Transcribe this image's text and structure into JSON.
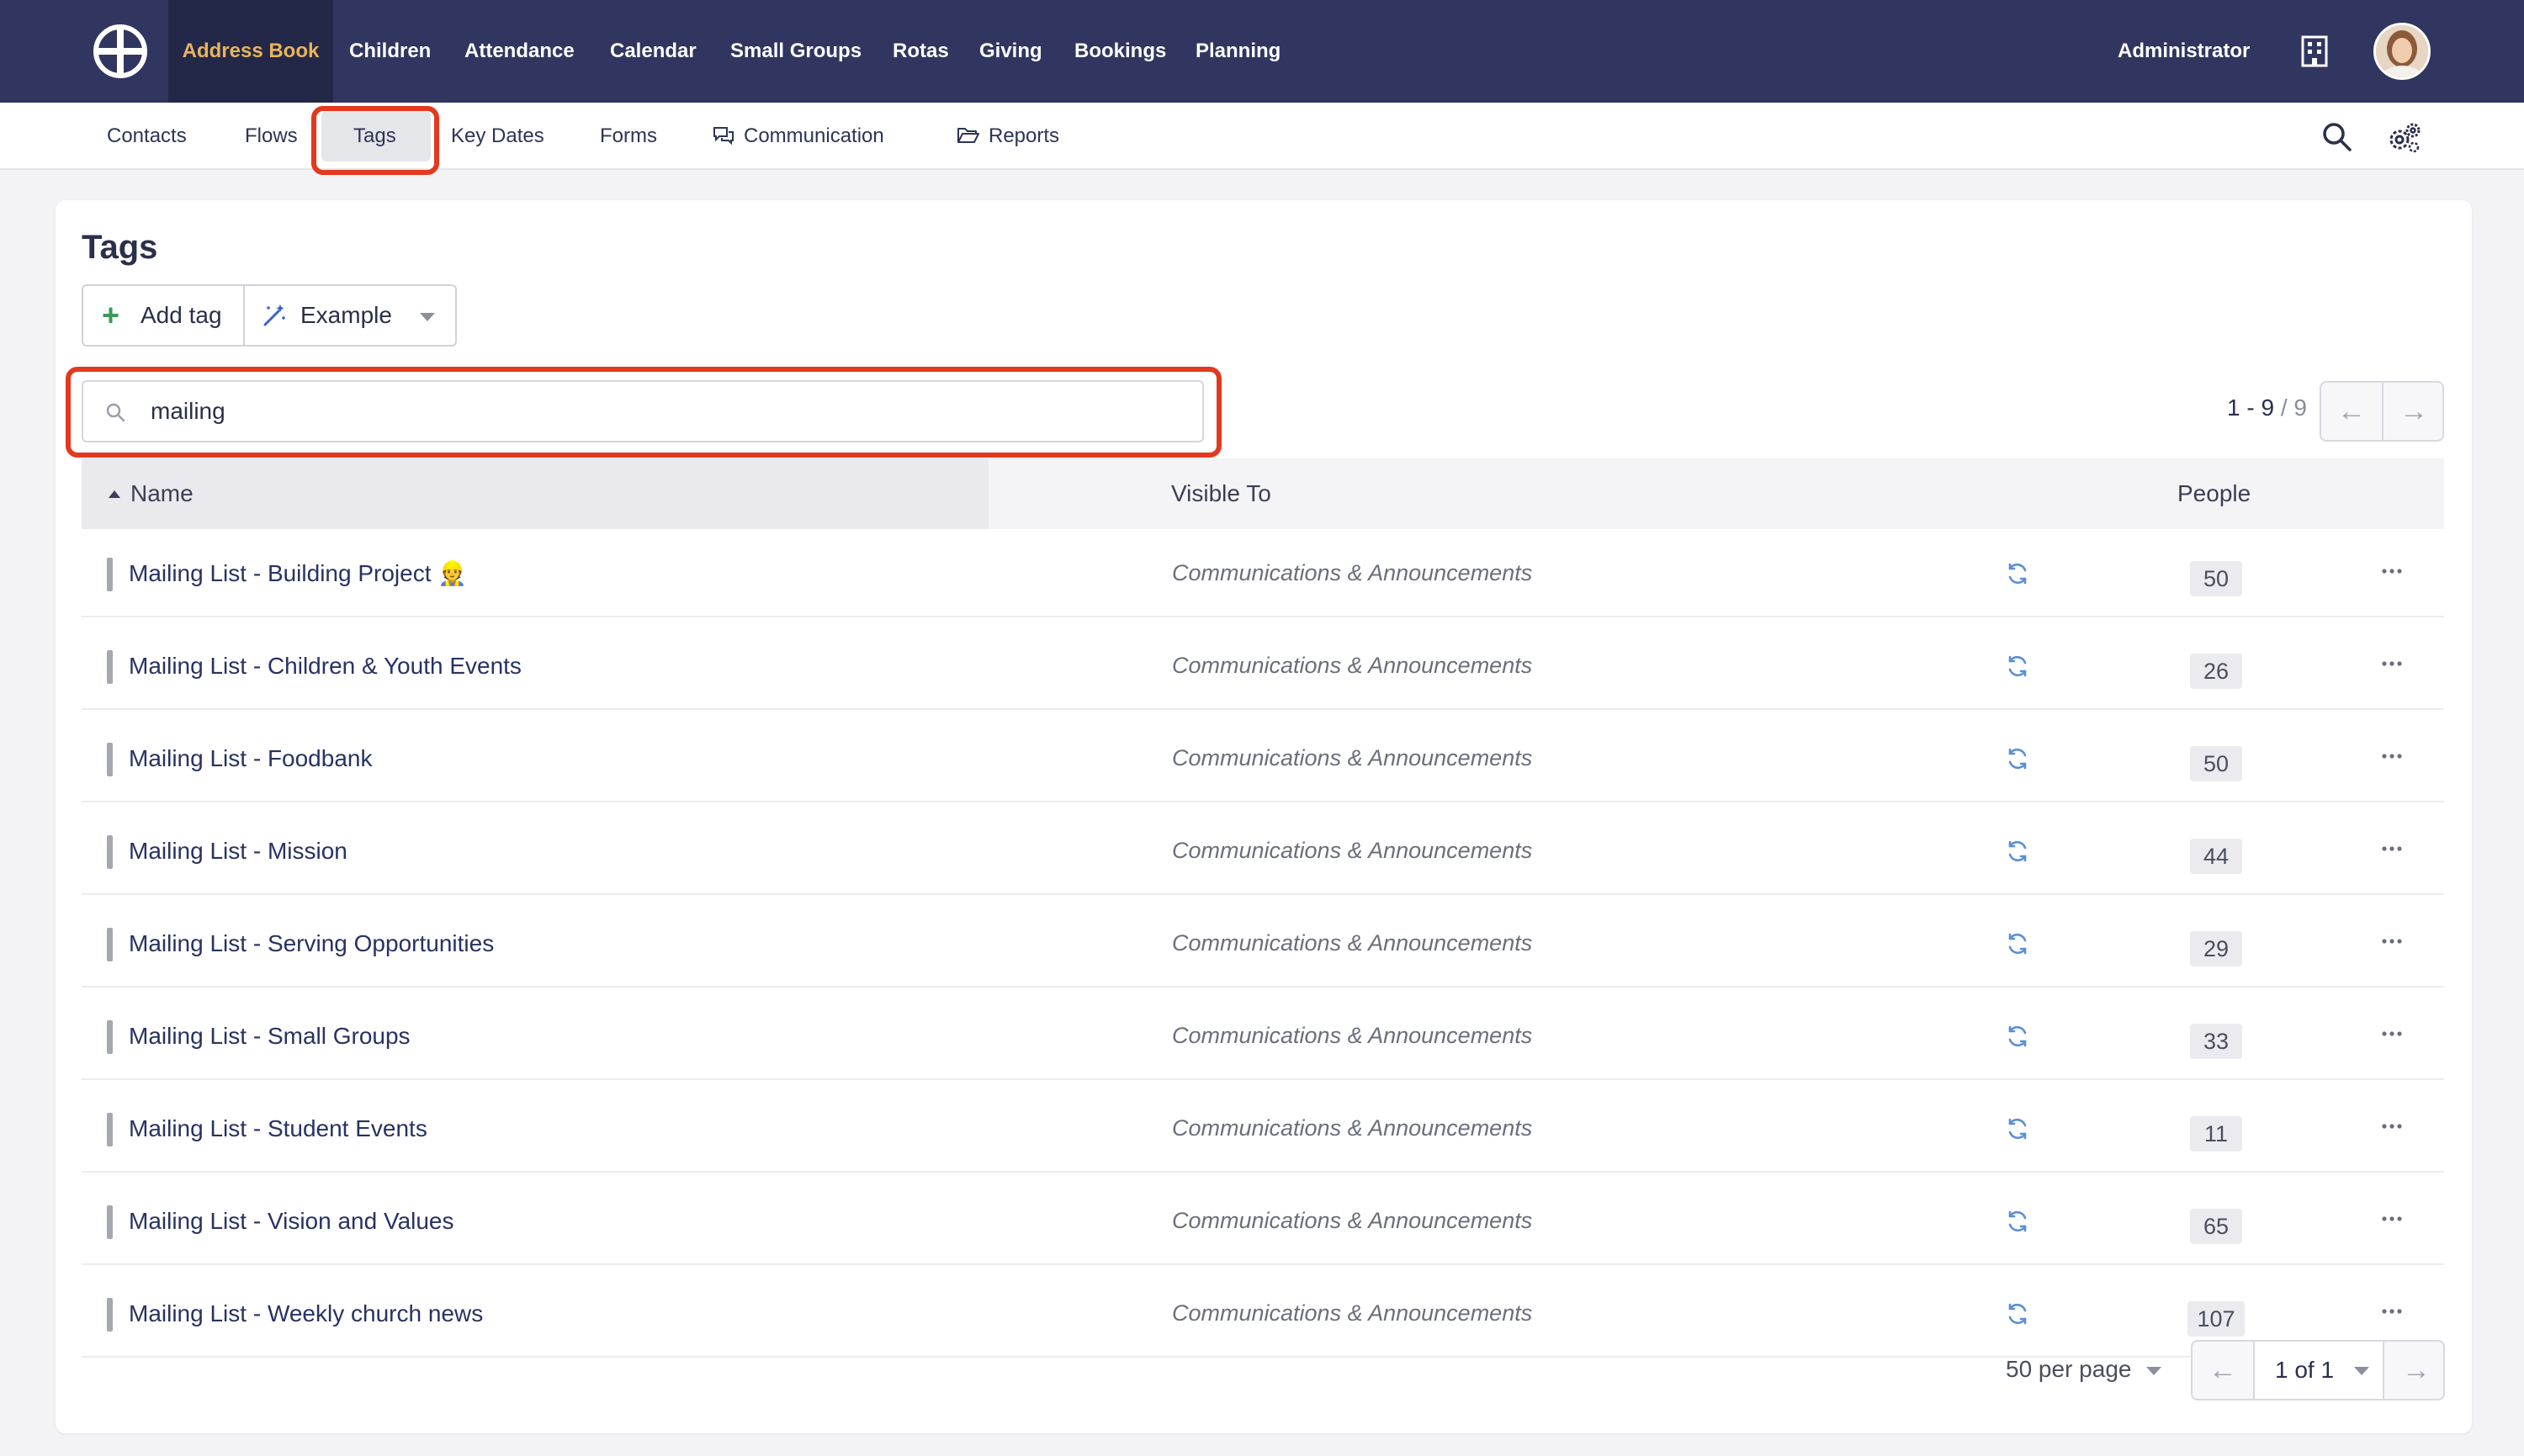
{
  "topnav": {
    "items": [
      {
        "label": "Address Book",
        "active": true
      },
      {
        "label": "Children"
      },
      {
        "label": "Attendance"
      },
      {
        "label": "Calendar"
      },
      {
        "label": "Small Groups"
      },
      {
        "label": "Rotas"
      },
      {
        "label": "Giving"
      },
      {
        "label": "Bookings"
      },
      {
        "label": "Planning"
      }
    ],
    "user_label": "Administrator",
    "icons": {
      "logo": "church-cross-logo",
      "org": "building-icon",
      "avatar": "user-avatar"
    }
  },
  "subnav": {
    "items": [
      {
        "label": "Contacts"
      },
      {
        "label": "Flows"
      },
      {
        "label": "Tags",
        "active": true
      },
      {
        "label": "Key Dates"
      },
      {
        "label": "Forms"
      },
      {
        "label": "Communication",
        "icon": "chat-bubbles-icon"
      },
      {
        "label": "Reports",
        "icon": "folder-open-icon"
      }
    ]
  },
  "page": {
    "title": "Tags",
    "add_tag_label": "Add tag",
    "example_label": "Example",
    "search": {
      "value": "mailing",
      "placeholder": ""
    },
    "range": {
      "current": "1 - 9",
      "total": " / 9"
    }
  },
  "table": {
    "headers": {
      "name": "Name",
      "visible_to": "Visible To",
      "people": "People"
    },
    "rows": [
      {
        "name": "Mailing List - Building Project 👷",
        "visible_to": "Communications & Announcements",
        "people": "50"
      },
      {
        "name": "Mailing List - Children & Youth Events",
        "visible_to": "Communications & Announcements",
        "people": "26"
      },
      {
        "name": "Mailing List - Foodbank",
        "visible_to": "Communications & Announcements",
        "people": "50"
      },
      {
        "name": "Mailing List - Mission",
        "visible_to": "Communications & Announcements",
        "people": "44"
      },
      {
        "name": "Mailing List - Serving Opportunities",
        "visible_to": "Communications & Announcements",
        "people": "29"
      },
      {
        "name": "Mailing List - Small Groups",
        "visible_to": "Communications & Announcements",
        "people": "33"
      },
      {
        "name": "Mailing List - Student Events",
        "visible_to": "Communications & Announcements",
        "people": "11"
      },
      {
        "name": "Mailing List - Vision and Values",
        "visible_to": "Communications & Announcements",
        "people": "65"
      },
      {
        "name": "Mailing List - Weekly church news",
        "visible_to": "Communications & Announcements",
        "people": "107"
      }
    ]
  },
  "footer": {
    "per_page": "50 per page",
    "page_of": "1 of 1"
  },
  "colors": {
    "nav_bg": "#30365f",
    "nav_active_text": "#e9b45a",
    "highlight": "#e2391f",
    "link": "#283262",
    "sync_icon": "#5b8fd6"
  }
}
